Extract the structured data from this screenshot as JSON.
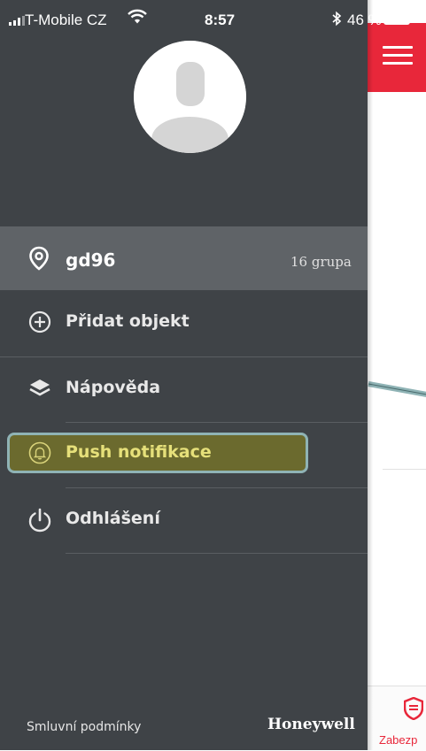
{
  "status_bar": {
    "carrier": "T-Mobile CZ",
    "time": "8:57",
    "battery_percent_text": "46 %",
    "icons": [
      "signal-icon",
      "wifi-icon",
      "bluetooth-icon",
      "battery-icon"
    ]
  },
  "drawer": {
    "location": {
      "name": "gd96",
      "group": "16 grupa",
      "icon": "location-pin-icon"
    },
    "menu_items": [
      {
        "label": "Přidat objekt",
        "icon": "plus-circle-icon"
      },
      {
        "label": "Nápověda",
        "icon": "layers-icon"
      },
      {
        "label": "Push notifikace",
        "icon": "bell-icon",
        "highlighted": true
      },
      {
        "label": "Odhlášení",
        "icon": "power-icon"
      }
    ],
    "footer": {
      "terms_link": "Smluvní podmínky",
      "brand": "Honeywell"
    }
  },
  "background_app": {
    "bottom_tab_label": "Zabezp",
    "accent_color": "#e8273a"
  },
  "colors": {
    "drawer_bg": "#3f4347",
    "selected_row_bg": "#5f6367",
    "highlight_fill": "#6b6a2e",
    "highlight_border": "#8fb3b5",
    "highlight_text": "#e6e07a"
  }
}
